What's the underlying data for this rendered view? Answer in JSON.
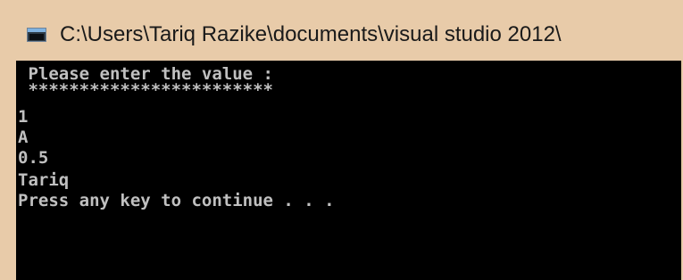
{
  "window": {
    "title": "C:\\Users\\Tariq Razike\\documents\\visual studio 2012\\"
  },
  "console": {
    "lines": [
      " Please enter the value :",
      " ************************",
      "1",
      "A",
      "0.5",
      "Tariq",
      "Press any key to continue . . ."
    ]
  },
  "colors": {
    "console_background": "#000000",
    "console_text": "#c0c0c0",
    "window_frame": "#e8cba9"
  },
  "icons": {
    "app_icon": "console-window-icon"
  }
}
